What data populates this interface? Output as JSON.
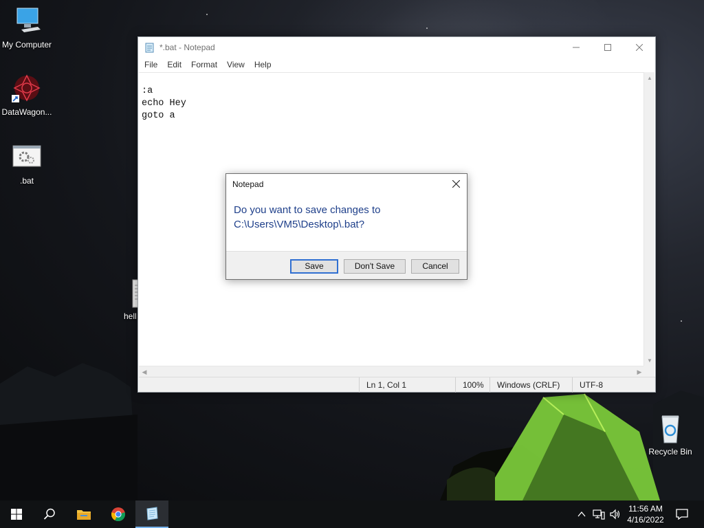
{
  "desktop": {
    "icons": [
      {
        "label": "My Computer",
        "icon": "computer-icon"
      },
      {
        "label": "DataWagon...",
        "icon": "datawagon-icon"
      },
      {
        "label": ".bat",
        "icon": "batch-file-icon"
      },
      {
        "label": "hell",
        "icon": "text-file-icon"
      },
      {
        "label": "Recycle Bin",
        "icon": "recycle-bin-icon"
      }
    ]
  },
  "notepad": {
    "title": "*.bat - Notepad",
    "menu": [
      "File",
      "Edit",
      "Format",
      "View",
      "Help"
    ],
    "content": ":a\necho Hey\ngoto a",
    "status": {
      "position": "Ln 1, Col 1",
      "zoom": "100%",
      "line_ending": "Windows (CRLF)",
      "encoding": "UTF-8"
    }
  },
  "dialog": {
    "title": "Notepad",
    "message": "Do you want to save changes to C:\\Users\\VM5\\Desktop\\.bat?",
    "buttons": {
      "save": "Save",
      "dont_save": "Don't Save",
      "cancel": "Cancel"
    }
  },
  "taskbar": {
    "clock": {
      "time": "11:56 AM",
      "date": "4/16/2022"
    },
    "accent": "#78b4ee"
  }
}
